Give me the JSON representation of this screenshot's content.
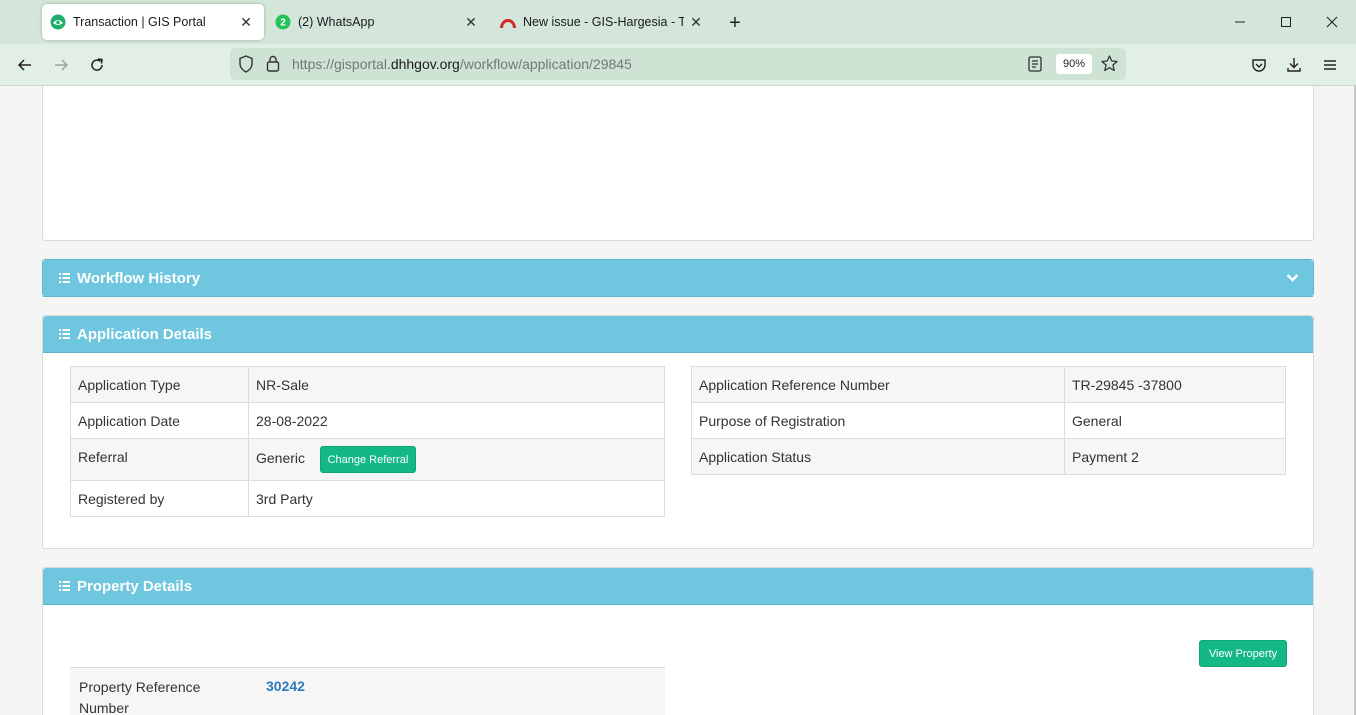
{
  "browser": {
    "tabs": [
      {
        "title": "Transaction | GIS Portal",
        "active": true,
        "icon": "gis-portal-icon"
      },
      {
        "title": "(2) WhatsApp",
        "active": false,
        "icon": "whatsapp-icon",
        "badge": "2"
      },
      {
        "title": "New issue - GIS-Hargesia - Team",
        "active": false,
        "icon": "arch-logo-icon"
      }
    ],
    "url": {
      "prefix": "https://gisportal.",
      "host": "dhhgov.org",
      "path": "/workflow/application/29845"
    },
    "zoom": "90%"
  },
  "sections": {
    "workflow_history": "Workflow History",
    "application_details": "Application Details",
    "property_details": "Property Details"
  },
  "application_details": {
    "left": [
      {
        "label": "Application Type",
        "value": "NR-Sale"
      },
      {
        "label": "Application Date",
        "value": "28-08-2022"
      },
      {
        "label": "Referral",
        "value": "Generic"
      },
      {
        "label": "Registered by",
        "value": "3rd Party"
      }
    ],
    "change_referral_label": "Change Referral",
    "right": [
      {
        "label": "Application Reference Number",
        "value": "TR-29845 -37800"
      },
      {
        "label": "Purpose of Registration",
        "value": "General"
      },
      {
        "label": "Application Status",
        "value": "Payment 2"
      }
    ]
  },
  "property_details": {
    "view_property_label": "View Property",
    "reference_label": "Property Reference Number",
    "reference_value": "30242"
  },
  "colors": {
    "panel_header": "#6ec6df",
    "button_green": "#14b886",
    "link_blue": "#2e7ab8"
  }
}
